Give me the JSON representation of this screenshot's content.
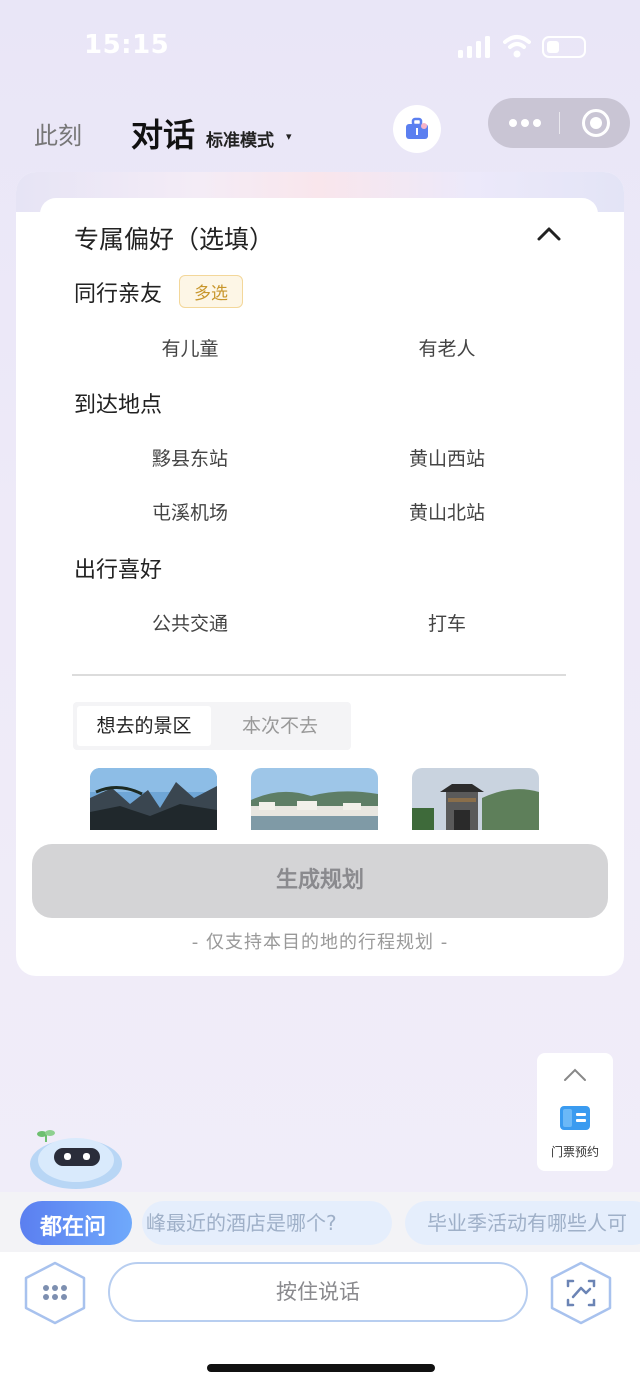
{
  "status_bar": {
    "time": "15:15"
  },
  "nav": {
    "now_tab": "此刻",
    "chat_tab": "对话",
    "mode_label": "标准模式",
    "mode_caret": "▾"
  },
  "preferences": {
    "title": "专属偏好（选填）",
    "companions": {
      "label": "同行亲友",
      "badge": "多选",
      "options": [
        "有儿童",
        "有老人"
      ]
    },
    "arrival": {
      "label": "到达地点",
      "options": [
        "黟县东站",
        "黄山西站",
        "屯溪机场",
        "黄山北站"
      ]
    },
    "travel": {
      "label": "出行喜好",
      "options": [
        "公共交通",
        "打车"
      ]
    }
  },
  "scenic": {
    "tabs": [
      "想去的景区",
      "本次不去"
    ],
    "active_tab": 0
  },
  "generate": {
    "button_label": "生成规划",
    "note": "- 仅支持本目的地的行程规划 -"
  },
  "ticket": {
    "label": "门票预约"
  },
  "ask_bar": {
    "badge": "都在问",
    "suggestions": [
      "峰最近的酒店是哪个?",
      "毕业季活动有哪些人可"
    ]
  },
  "input": {
    "voice_label": "按住说话"
  },
  "colors": {
    "accent_blue": "#5b7ff0",
    "badge_gold": "#c8962c",
    "disabled_gray": "#d4d4d6"
  }
}
